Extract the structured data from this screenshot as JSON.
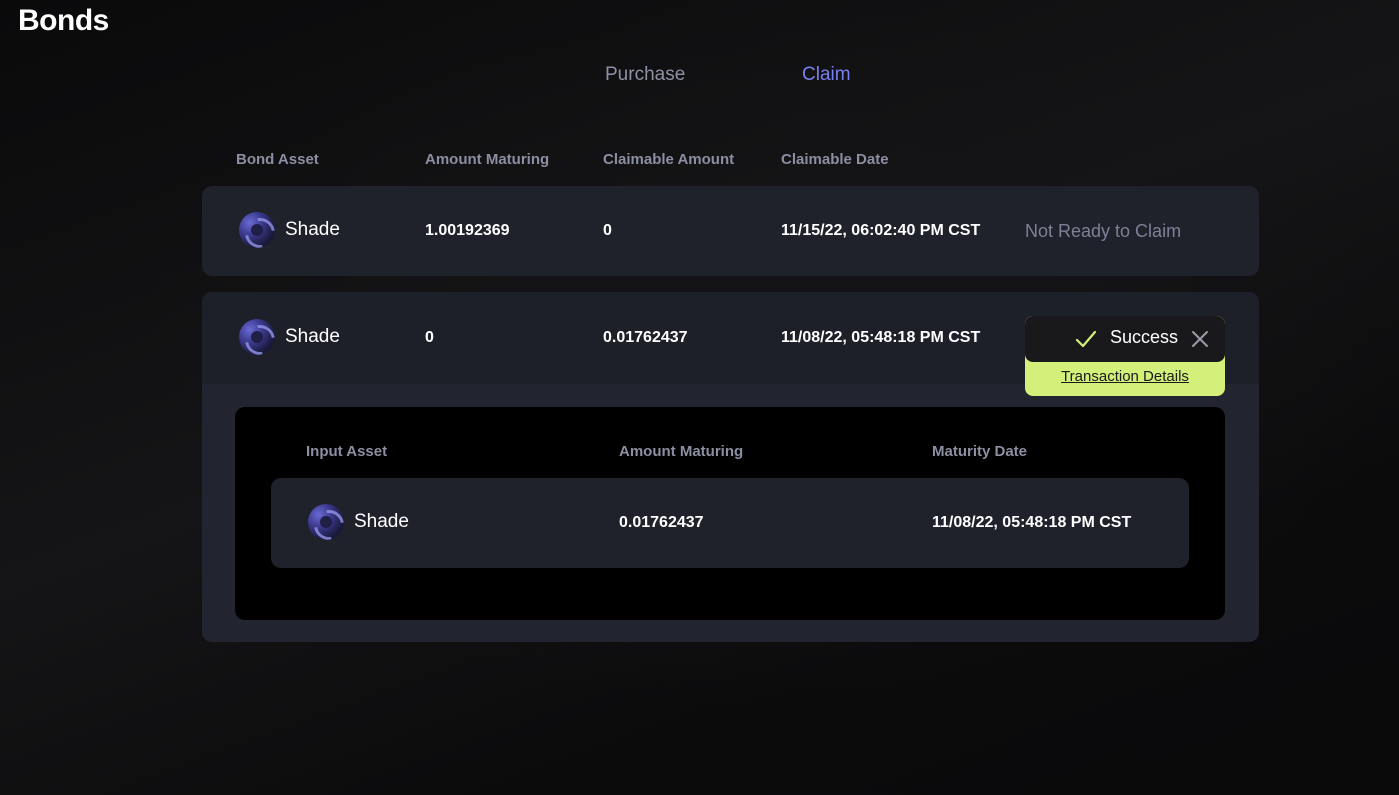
{
  "page": {
    "title": "Bonds"
  },
  "tabs": [
    {
      "label": "Purchase",
      "active": false
    },
    {
      "label": "Claim",
      "active": true
    }
  ],
  "table": {
    "headers": [
      "Bond Asset",
      "Amount Maturing",
      "Claimable Amount",
      "Claimable Date"
    ],
    "rows": [
      {
        "asset": "Shade",
        "amount_maturing": "1.00192369",
        "claimable_amount": "0",
        "claimable_date": "11/15/22, 06:02:40 PM CST",
        "status": "Not Ready to Claim"
      },
      {
        "asset": "Shade",
        "amount_maturing": "0",
        "claimable_amount": "0.01762437",
        "claimable_date": "11/08/22, 05:48:18 PM CST",
        "expanded": true
      }
    ]
  },
  "details": {
    "headers": [
      "Input Asset",
      "Amount Maturing",
      "Maturity Date"
    ],
    "rows": [
      {
        "asset": "Shade",
        "amount_maturing": "0.01762437",
        "maturity_date": "11/08/22, 05:48:18 PM CST"
      }
    ]
  },
  "toast": {
    "label": "Success",
    "link": "Transaction Details",
    "check_icon": "check-icon",
    "close_icon": "close-icon"
  },
  "colors": {
    "accent": "#7b7ff0",
    "success": "#d3f07a",
    "card": "#1f212b",
    "muted": "#8c8ea2"
  }
}
